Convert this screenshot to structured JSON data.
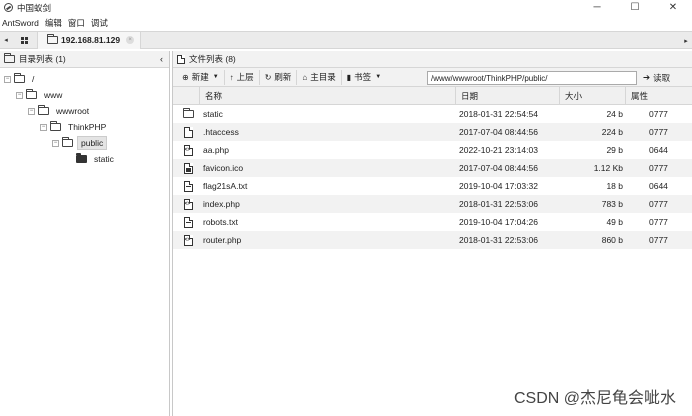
{
  "window": {
    "title": "中国蚁剑",
    "controls": [
      "─",
      "☐",
      "✕"
    ]
  },
  "menu": [
    "AntSword",
    "编辑",
    "窗口",
    "调试"
  ],
  "tabs": {
    "scroll_left": "◂",
    "scroll_right": "▸",
    "active_label": "192.168.81.129",
    "close": "×"
  },
  "left_panel": {
    "header": "目录列表 (1)",
    "collapse_icon": "‹",
    "tree": [
      {
        "label": "/",
        "toggle": "−",
        "icon": "folder-outline-icon"
      },
      {
        "label": "www",
        "toggle": "−",
        "icon": "folder-outline-icon"
      },
      {
        "label": "wwwroot",
        "toggle": "−",
        "icon": "folder-outline-icon"
      },
      {
        "label": "ThinkPHP",
        "toggle": "−",
        "icon": "folder-outline-icon"
      },
      {
        "label": "public",
        "toggle": "−",
        "icon": "folder-outline-icon",
        "selected": true
      },
      {
        "label": "static",
        "toggle": "",
        "icon": "folder-solid-icon"
      }
    ]
  },
  "right_panel": {
    "header": "文件列表 (8)",
    "toolbar": {
      "new": "新建",
      "up": "上层",
      "refresh": "刷新",
      "home": "主目录",
      "bookmark": "书签",
      "path": "/www/wwwroot/ThinkPHP/public/",
      "read": "读取"
    },
    "columns": {
      "name": "名称",
      "date": "日期",
      "size": "大小",
      "perm": "属性"
    },
    "files": [
      {
        "icon": "folder-icon",
        "name": "static",
        "date": "2018-01-31 22:54:54",
        "size": "24 b",
        "perm": "0777"
      },
      {
        "icon": "file-icon",
        "name": ".htaccess",
        "date": "2017-07-04 08:44:56",
        "size": "224 b",
        "perm": "0777"
      },
      {
        "icon": "code-file-icon",
        "name": "aa.php",
        "date": "2022-10-21 23:14:03",
        "size": "29 b",
        "perm": "0644"
      },
      {
        "icon": "image-file-icon",
        "name": "favicon.ico",
        "date": "2017-07-04 08:44:56",
        "size": "1.12 Kb",
        "perm": "0777"
      },
      {
        "icon": "text-file-icon",
        "name": "flag21sA.txt",
        "date": "2019-10-04 17:03:32",
        "size": "18 b",
        "perm": "0644"
      },
      {
        "icon": "code-file-icon",
        "name": "index.php",
        "date": "2018-01-31 22:53:06",
        "size": "783 b",
        "perm": "0777"
      },
      {
        "icon": "text-file-icon",
        "name": "robots.txt",
        "date": "2019-10-04 17:04:26",
        "size": "49 b",
        "perm": "0777"
      },
      {
        "icon": "code-file-icon",
        "name": "router.php",
        "date": "2018-01-31 22:53:06",
        "size": "860 b",
        "perm": "0777"
      }
    ]
  },
  "watermark": "CSDN @杰尼龟会呲水"
}
